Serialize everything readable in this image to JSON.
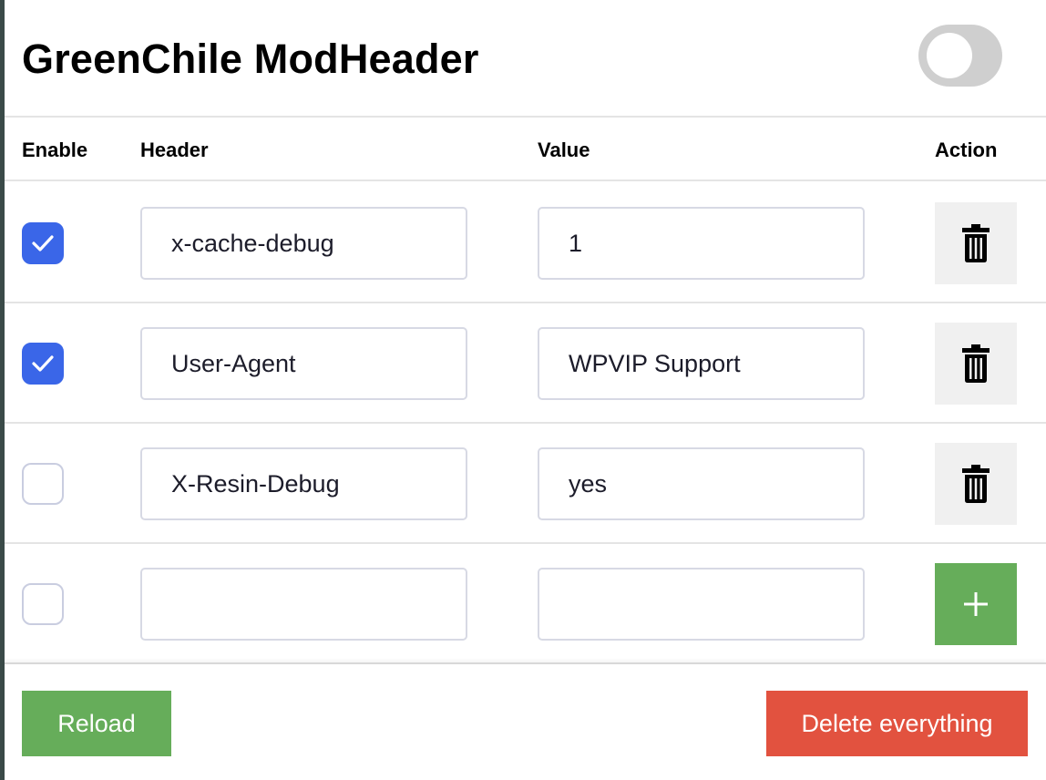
{
  "app": {
    "title": "GreenChile ModHeader",
    "master_toggle": {
      "on": false
    }
  },
  "table": {
    "columns": {
      "enable": "Enable",
      "header": "Header",
      "value": "Value",
      "action": "Action"
    },
    "rows": [
      {
        "enabled": true,
        "header": "x-cache-debug",
        "value": "1",
        "action": "trash-icon"
      },
      {
        "enabled": true,
        "header": "User-Agent",
        "value": "WPVIP Support",
        "action": "trash-icon"
      },
      {
        "enabled": false,
        "header": "X-Resin-Debug",
        "value": "yes",
        "action": "trash-icon"
      },
      {
        "enabled": false,
        "header": "",
        "value": "",
        "action": "plus-icon"
      }
    ]
  },
  "footer": {
    "reload_label": "Reload",
    "delete_label": "Delete everything"
  },
  "colors": {
    "checkbox_on": "#3a66e8",
    "add_button": "#66ad5a",
    "reload_button": "#66ad5a",
    "delete_button": "#e2523f",
    "toggle_off": "#cfcfcf"
  }
}
